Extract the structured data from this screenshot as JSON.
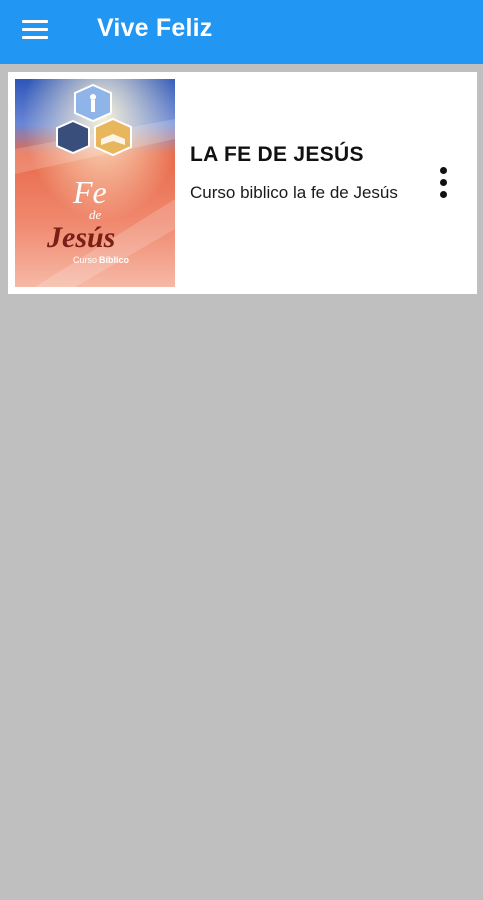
{
  "appbar": {
    "title": "Vive Feliz",
    "menu_icon": "hamburger-menu-icon",
    "background": "#2196f3"
  },
  "courses": [
    {
      "title": "LA FE DE JESÚS",
      "subtitle": "Curso biblico la fe de Jesús",
      "thumbnail": {
        "line1": "Fe",
        "line2": "de",
        "line3": "Jesús",
        "caption_prefix": "Curso",
        "caption_bold": "Bíblico"
      },
      "more_icon": "more-vert-icon"
    }
  ],
  "colors": {
    "content_background": "#bfbfbf",
    "card_background": "#ffffff"
  }
}
